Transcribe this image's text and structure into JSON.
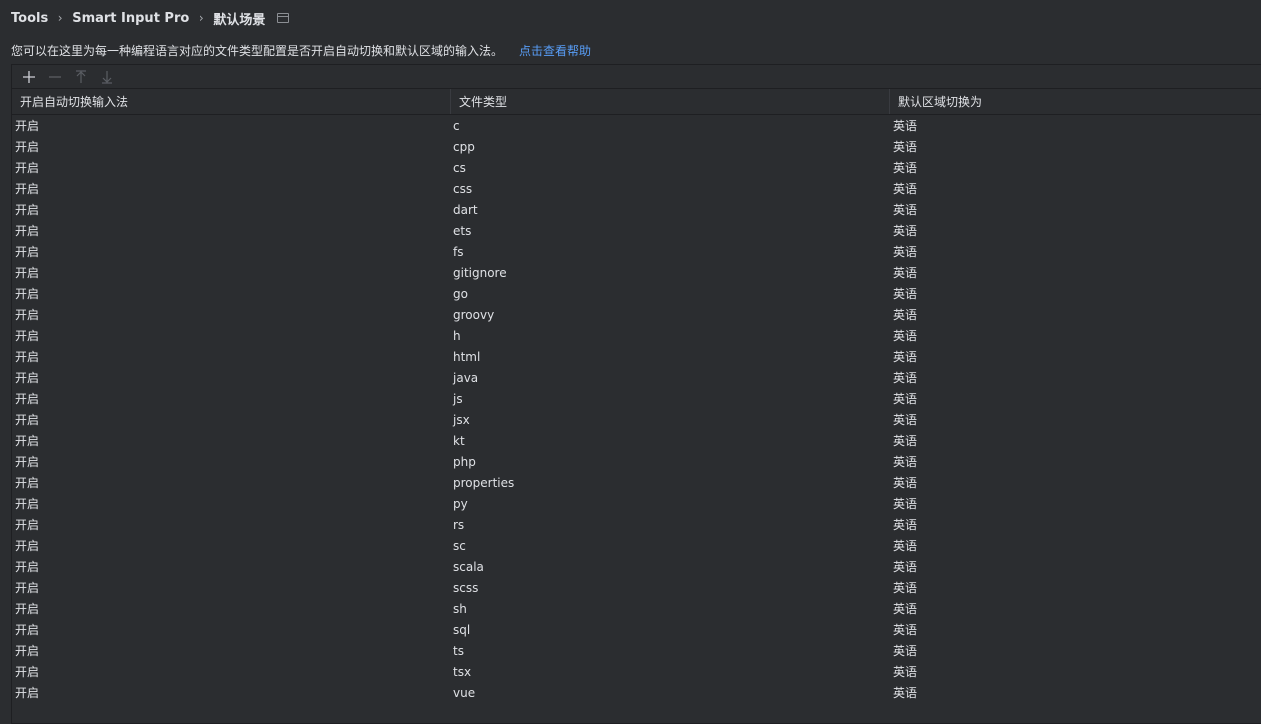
{
  "breadcrumb": {
    "items": [
      "Tools",
      "Smart Input Pro",
      "默认场景"
    ],
    "separator": "›"
  },
  "description": {
    "text": "您可以在这里为每一种编程语言对应的文件类型配置是否开启自动切换和默认区域的输入法。",
    "help_link": "点击查看帮助"
  },
  "toolbar": {
    "buttons": [
      {
        "icon": "plus-icon",
        "enabled": true
      },
      {
        "icon": "minus-icon",
        "enabled": false
      },
      {
        "icon": "arrow-up-icon",
        "enabled": false
      },
      {
        "icon": "arrow-down-icon",
        "enabled": false
      }
    ]
  },
  "table": {
    "columns": [
      "开启自动切换输入法",
      "文件类型",
      "默认区域切换为"
    ],
    "rows": [
      [
        "开启",
        "c",
        "英语"
      ],
      [
        "开启",
        "cpp",
        "英语"
      ],
      [
        "开启",
        "cs",
        "英语"
      ],
      [
        "开启",
        "css",
        "英语"
      ],
      [
        "开启",
        "dart",
        "英语"
      ],
      [
        "开启",
        "ets",
        "英语"
      ],
      [
        "开启",
        "fs",
        "英语"
      ],
      [
        "开启",
        "gitignore",
        "英语"
      ],
      [
        "开启",
        "go",
        "英语"
      ],
      [
        "开启",
        "groovy",
        "英语"
      ],
      [
        "开启",
        "h",
        "英语"
      ],
      [
        "开启",
        "html",
        "英语"
      ],
      [
        "开启",
        "java",
        "英语"
      ],
      [
        "开启",
        "js",
        "英语"
      ],
      [
        "开启",
        "jsx",
        "英语"
      ],
      [
        "开启",
        "kt",
        "英语"
      ],
      [
        "开启",
        "php",
        "英语"
      ],
      [
        "开启",
        "properties",
        "英语"
      ],
      [
        "开启",
        "py",
        "英语"
      ],
      [
        "开启",
        "rs",
        "英语"
      ],
      [
        "开启",
        "sc",
        "英语"
      ],
      [
        "开启",
        "scala",
        "英语"
      ],
      [
        "开启",
        "scss",
        "英语"
      ],
      [
        "开启",
        "sh",
        "英语"
      ],
      [
        "开启",
        "sql",
        "英语"
      ],
      [
        "开启",
        "ts",
        "英语"
      ],
      [
        "开启",
        "tsx",
        "英语"
      ],
      [
        "开启",
        "vue",
        "英语"
      ]
    ]
  },
  "colors": {
    "background": "#2b2d30",
    "text": "#dfe1e5",
    "link": "#589df6",
    "border": "#1e1f22"
  }
}
